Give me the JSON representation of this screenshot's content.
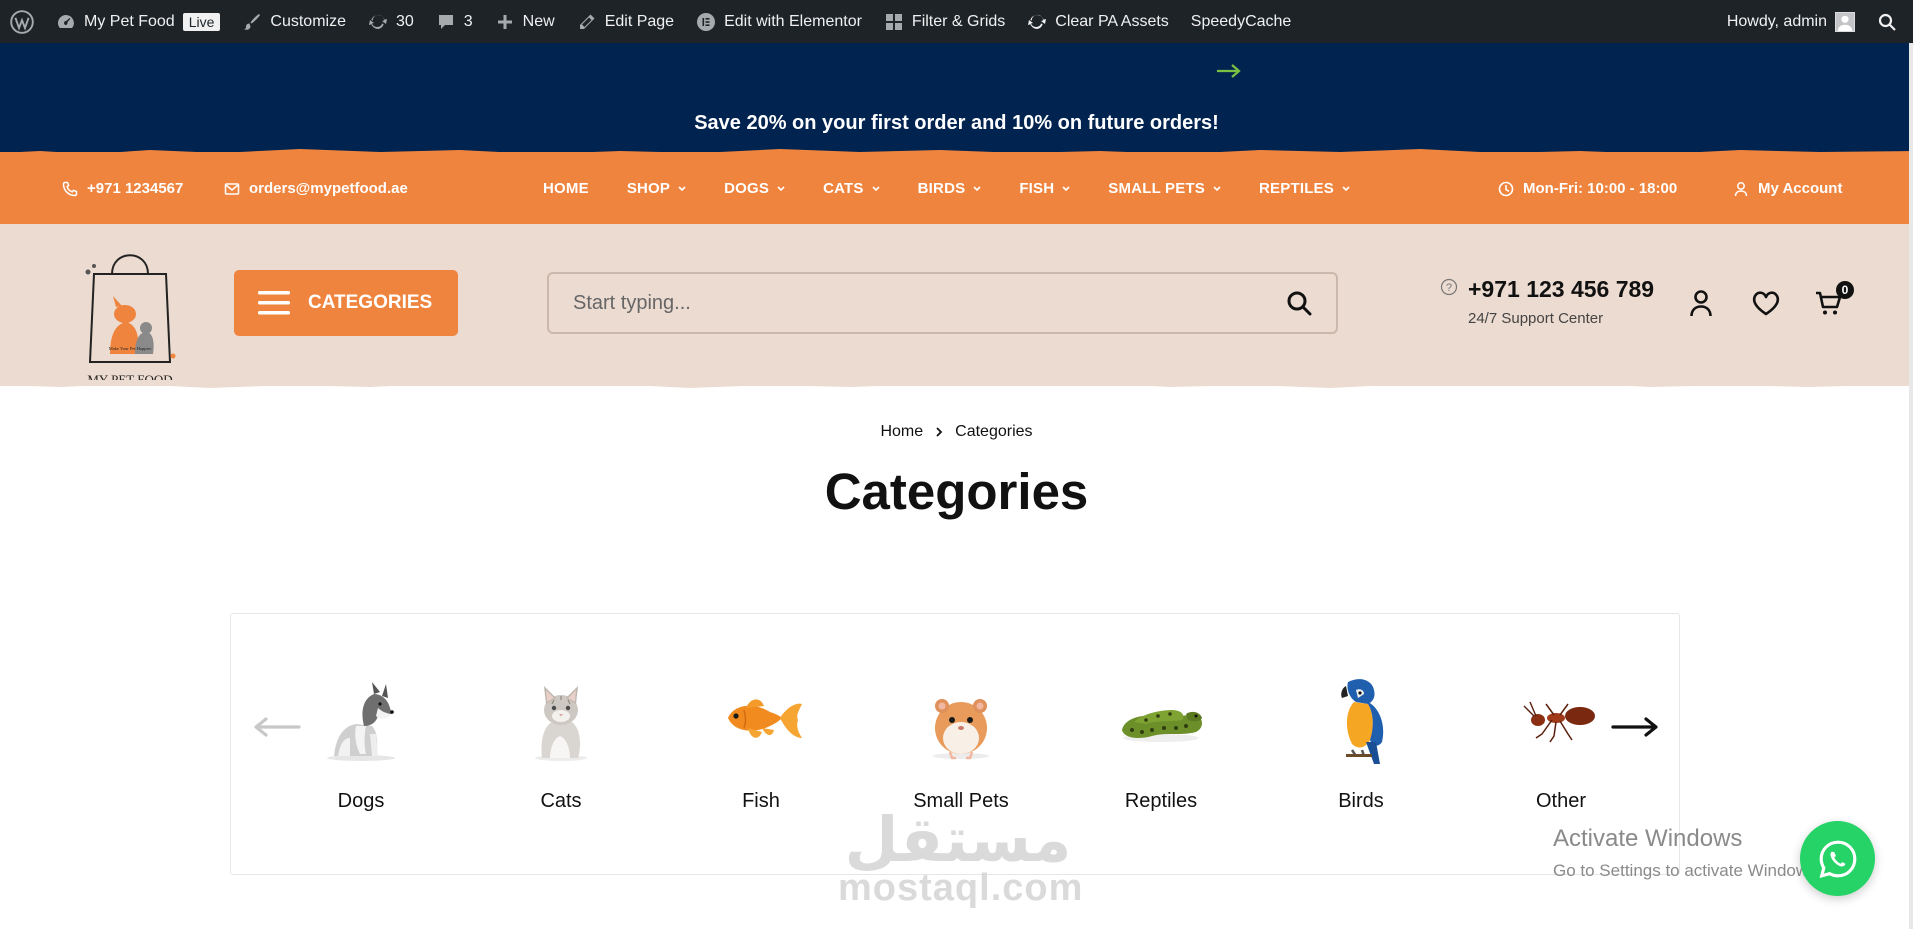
{
  "adminbar": {
    "site_name": "My Pet Food",
    "live_label": "Live",
    "customize": "Customize",
    "updates_count": "30",
    "comments_count": "3",
    "new_label": "New",
    "edit_page": "Edit Page",
    "edit_elementor": "Edit with Elementor",
    "filter_grids": "Filter & Grids",
    "clear_pa": "Clear PA Assets",
    "speedycache": "SpeedyCache",
    "howdy": "Howdy, admin"
  },
  "promo": {
    "text": "Save 20% on your first order and 10% on future orders!",
    "arrow_color": "#7ac143"
  },
  "topbar": {
    "phone": "+971 1234567",
    "email": "orders@mypetfood.ae",
    "hours": "Mon-Fri: 10:00 - 18:00",
    "account": "My Account",
    "nav": [
      {
        "label": "HOME",
        "dropdown": false
      },
      {
        "label": "SHOP",
        "dropdown": true
      },
      {
        "label": "DOGS",
        "dropdown": true
      },
      {
        "label": "CATS",
        "dropdown": true
      },
      {
        "label": "BIRDS",
        "dropdown": true
      },
      {
        "label": "FISH",
        "dropdown": true
      },
      {
        "label": "SMALL PETS",
        "dropdown": true
      },
      {
        "label": "REPTILES",
        "dropdown": true
      }
    ]
  },
  "header": {
    "logo_text": "MY PET FOOD",
    "categories_button": "CATEGORIES",
    "search_placeholder": "Start typing...",
    "support_phone": "+971 123 456 789",
    "support_label": "24/7 Support Center",
    "cart_count": "0"
  },
  "breadcrumb": {
    "home": "Home",
    "current": "Categories"
  },
  "page": {
    "title": "Categories"
  },
  "categories": [
    {
      "label": "Dogs",
      "icon": "dog-image"
    },
    {
      "label": "Cats",
      "icon": "cat-image"
    },
    {
      "label": "Fish",
      "icon": "fish-image"
    },
    {
      "label": "Small Pets",
      "icon": "hamster-image"
    },
    {
      "label": "Reptiles",
      "icon": "snake-image"
    },
    {
      "label": "Birds",
      "icon": "parrot-image"
    },
    {
      "label": "Other",
      "icon": "ant-image"
    }
  ],
  "overlays": {
    "watermark_ar": "مستقل",
    "watermark_en": "mostaql.com",
    "activate_title": "Activate Windows",
    "activate_sub": "Go to Settings to activate Windows."
  },
  "colors": {
    "navy": "#01234f",
    "orange": "#ef843e",
    "beige": "#ecdbd0",
    "whatsapp": "#25d366"
  }
}
